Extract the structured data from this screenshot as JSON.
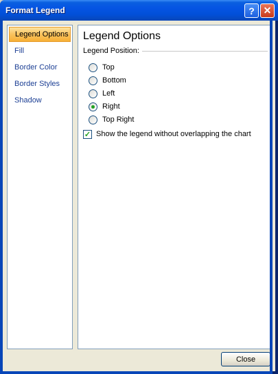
{
  "window": {
    "title": "Format Legend",
    "help_glyph": "?",
    "close_glyph": "✕"
  },
  "nav": {
    "items": [
      {
        "label": "Legend Options"
      },
      {
        "label": "Fill"
      },
      {
        "label": "Border Color"
      },
      {
        "label": "Border Styles"
      },
      {
        "label": "Shadow"
      }
    ],
    "selected_index": 0
  },
  "panel": {
    "title": "Legend Options",
    "section_label": "Legend Position:",
    "positions": [
      {
        "label": "Top",
        "selected": false
      },
      {
        "label": "Bottom",
        "selected": false
      },
      {
        "label": "Left",
        "selected": false
      },
      {
        "label": "Right",
        "selected": true
      },
      {
        "label": "Top Right",
        "selected": false
      }
    ],
    "overlap_checkbox": {
      "label": "Show the legend without overlapping the chart",
      "checked": true
    }
  },
  "footer": {
    "close_label": "Close"
  },
  "colors": {
    "title_bar": "#0554e3",
    "selected_nav": "#f9c25d",
    "radio_dot": "#21a121"
  }
}
